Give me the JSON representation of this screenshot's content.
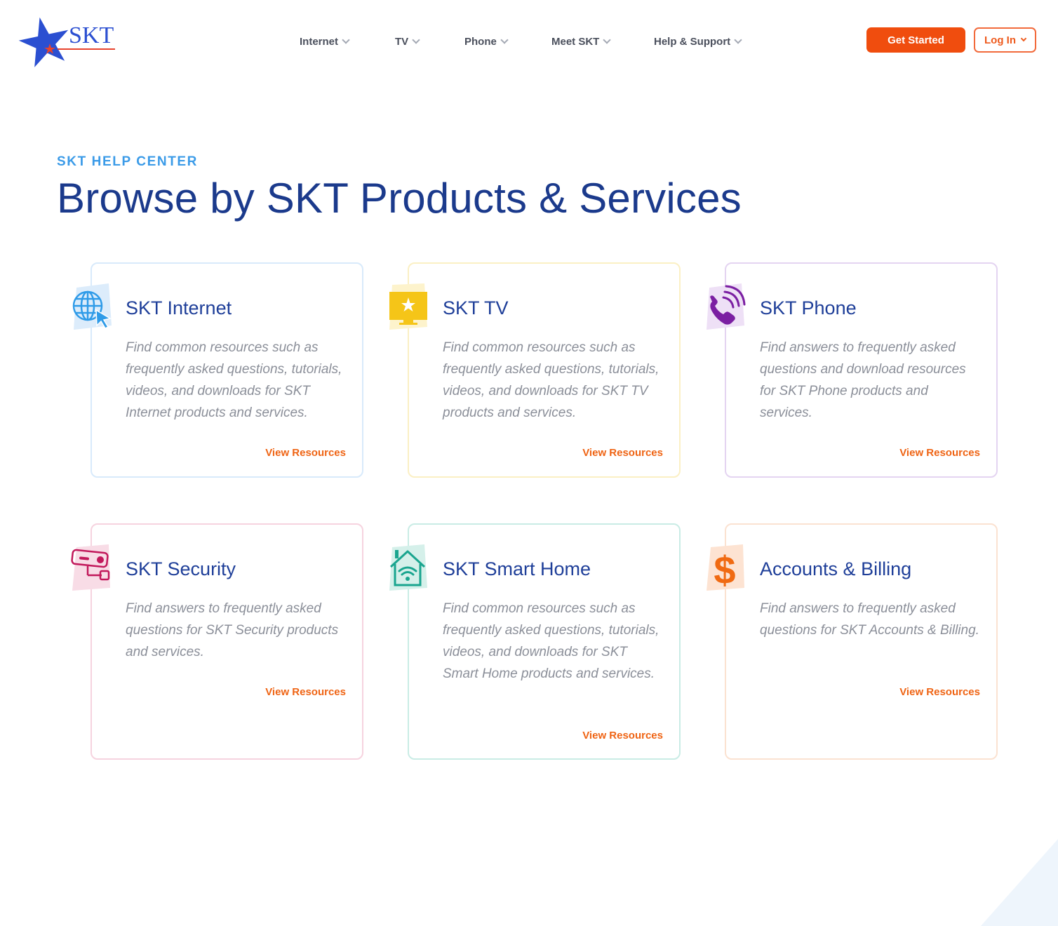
{
  "brand": {
    "name": "SKT"
  },
  "nav": {
    "items": [
      {
        "label": "Internet"
      },
      {
        "label": "TV"
      },
      {
        "label": "Phone"
      },
      {
        "label": "Meet SKT"
      },
      {
        "label": "Help & Support"
      }
    ],
    "get_started": "Get Started",
    "log_in": "Log In"
  },
  "hero": {
    "eyebrow": "SKT HELP CENTER",
    "title": "Browse by SKT Products & Services"
  },
  "cards": [
    {
      "title": "SKT Internet",
      "description": "Find common resources such as frequently asked questions, tutorials, videos, and downloads for SKT Internet products and services.",
      "link": "View Resources",
      "icon": "globe-cursor-icon",
      "accent": "#2f9be8"
    },
    {
      "title": "SKT TV",
      "description": "Find common resources such as frequently asked questions, tutorials, videos, and downloads for SKT TV products and services.",
      "link": "View Resources",
      "icon": "tv-star-icon",
      "accent": "#f1c40f"
    },
    {
      "title": "SKT Phone",
      "description": "Find answers to frequently asked questions and download resources for SKT Phone products and services.",
      "link": "View Resources",
      "icon": "phone-ringing-icon",
      "accent": "#7b1fa2"
    },
    {
      "title": "SKT Security",
      "description": "Find answers to frequently asked questions for SKT Security products and services.",
      "link": "View Resources",
      "icon": "security-camera-icon",
      "accent": "#c2185b"
    },
    {
      "title": "SKT Smart Home",
      "description": "Find common resources such as frequently asked questions, tutorials, videos, and downloads for SKT Smart Home products and services.",
      "link": "View Resources",
      "icon": "smart-home-wifi-icon",
      "accent": "#1aa58f"
    },
    {
      "title": "Accounts & Billing",
      "description": "Find answers to frequently asked questions for SKT Accounts & Billing.",
      "link": "View Resources",
      "icon": "dollar-sign-icon",
      "accent": "#f06a12"
    }
  ],
  "colors": {
    "primary_blue": "#1b3a8c",
    "eyebrow_blue": "#3b9be8",
    "cta_orange": "#f04d0e",
    "link_orange": "#ef6414"
  }
}
